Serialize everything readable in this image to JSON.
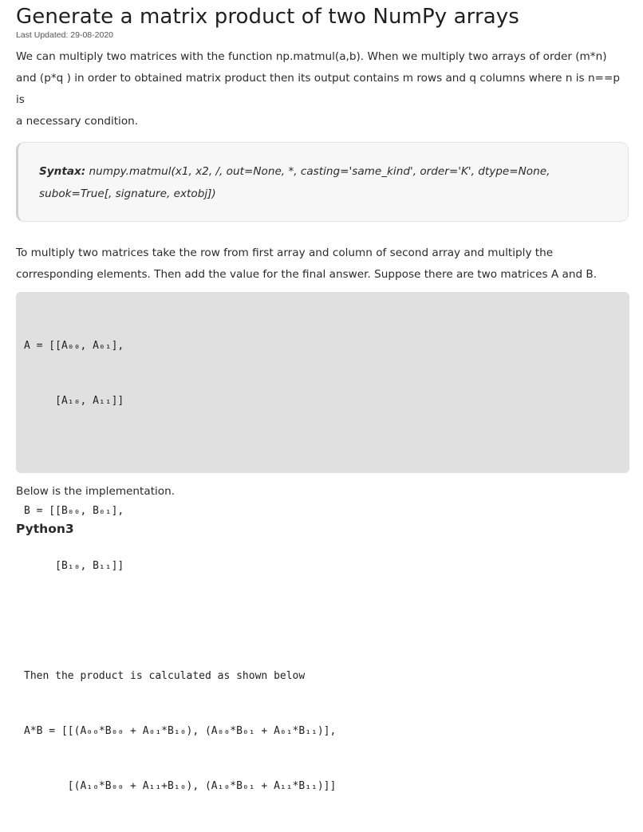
{
  "article": {
    "title": "Generate a matrix product of two NumPy arrays",
    "last_updated": "Last Updated: 29-08-2020",
    "intro_line_1": "We can multiply two matrices with the function np.matmul(a,b). When we multiply two arrays of order (m*n)",
    "intro_line_2": "and  (p*q ) in order to obtained matrix product then its output contains m rows and q columns where n is n==p is",
    "intro_line_3": "a necessary condition.",
    "syntax_label": "Syntax:",
    "syntax_line_1": " numpy.matmul(x1, x2, /, out=None, *, casting='same_kind', order='K', dtype=None,",
    "syntax_line_2": "subok=True[, signature, extobj])",
    "para2_line_1": "To multiply two matrices take the row from first array and column of second array and multiply the",
    "para2_line_2": "corresponding elements. Then add the value for the final answer. Suppose there are two matrices A and B.",
    "code_lines": [
      "A = [[A₀₀, A₀₁],",
      "     [A₁₀, A₁₁]]",
      "",
      "B = [[B₀₀, B₀₁],",
      "     [B₁₀, B₁₁]]",
      "",
      "Then the product is calculated as shown below",
      "A*B = [[(A₀₀*B₀₀ + A₀₁*B₁₀), (A₀₀*B₀₁ + A₀₁*B₁₁)],",
      "       [(A₁₀*B₀₀ + A₁₁+B₁₀), (A₁₀*B₀₁ + A₁₁*B₁₁)]]"
    ],
    "below_text": "Below is the implementation.",
    "language_tab": "Python3"
  }
}
